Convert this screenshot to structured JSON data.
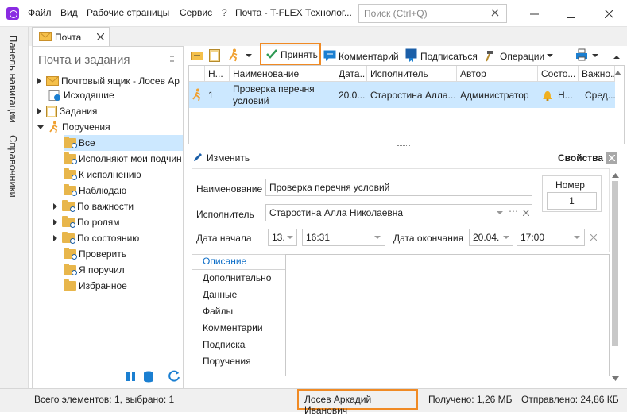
{
  "menu": [
    "Файл",
    "Вид",
    "Рабочие страницы",
    "Сервис",
    "?"
  ],
  "window_title": "Почта - T-FLEX Технолог...",
  "search": {
    "placeholder": "Поиск (Ctrl+Q)"
  },
  "rail": {
    "nav_panel": "Панель навигации",
    "directories": "Справочники"
  },
  "tab": {
    "label": "Почта"
  },
  "nav": {
    "title": "Почта и задания",
    "items": [
      {
        "label": "Почтовый ящик - Лосев Ар"
      },
      {
        "label": "Исходящие"
      },
      {
        "label": "Задания"
      },
      {
        "label": "Поручения"
      },
      {
        "label": "Все"
      },
      {
        "label": "Исполняют мои подчин"
      },
      {
        "label": "К исполнению"
      },
      {
        "label": "Наблюдаю"
      },
      {
        "label": "По важности"
      },
      {
        "label": "По ролям"
      },
      {
        "label": "По состоянию"
      },
      {
        "label": "Проверить"
      },
      {
        "label": "Я поручил"
      },
      {
        "label": "Избранное"
      }
    ]
  },
  "toolbar": {
    "accept": "Принять",
    "comment": "Комментарий",
    "sign": "Подписаться",
    "operations": "Операции"
  },
  "grid": {
    "headers": [
      "Н...",
      "Наименование",
      "Дата...",
      "Исполнитель",
      "Автор",
      "Состо...",
      "Важно..."
    ],
    "row": [
      "1",
      "Проверка перечня условий",
      "20.0...",
      "Старостина Алла...",
      "Администратор",
      "Н...",
      "Сред..."
    ]
  },
  "props": {
    "edit": "Изменить",
    "title": "Свойства",
    "name_label": "Наименование",
    "name_value": "Проверка перечня условий",
    "number_label": "Номер",
    "number_value": "1",
    "executor_label": "Исполнитель",
    "executor_value": "Старостина Алла Николаевна",
    "start_label": "Дата начала",
    "start_date": "13.",
    "start_time": "16:31",
    "end_label": "Дата окончания",
    "end_date": "20.04.",
    "end_time": "17:00",
    "tabs": [
      "Описание",
      "Дополнительно",
      "Данные",
      "Файлы",
      "Комментарии",
      "Подписка",
      "Поручения"
    ]
  },
  "status": {
    "count": "Всего элементов: 1, выбрано: 1",
    "user": "Лосев Аркадий Иванович",
    "received": "Получено: 1,26 МБ",
    "sent": "Отправлено: 24,86 КБ"
  },
  "colors": {
    "accent": "#0a6cc7",
    "highlight": "#f08a24",
    "selection": "#cce8ff",
    "folder": "#e8b64b"
  }
}
